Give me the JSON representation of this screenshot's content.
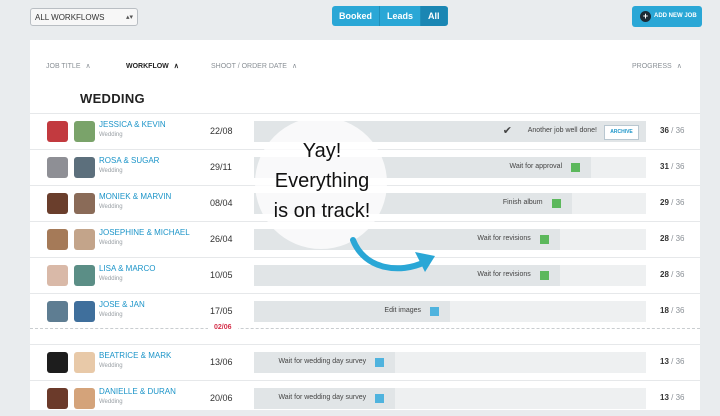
{
  "toolbar": {
    "workflow_select": "ALL WORKFLOWS",
    "filters": [
      "Booked",
      "Leads",
      "All"
    ],
    "active_filter": "All",
    "add_job_label": "ADD NEW JOB"
  },
  "table": {
    "headers": {
      "job_title": "JOB TITLE",
      "workflow": "WORKFLOW",
      "shoot_date": "SHOOT / ORDER DATE",
      "progress": "PROGRESS"
    },
    "section": "WEDDING",
    "rows": [
      {
        "name": "JESSICA & KEVIN",
        "type": "Wedding",
        "date": "22/08",
        "stage": "Another job well done!",
        "progress": 1.0,
        "done": "36",
        "total": "36",
        "archive": "ARCHIVE",
        "status_color": "none"
      },
      {
        "name": "ROSA & SUGAR",
        "type": "Wedding",
        "date": "29/11",
        "stage": "Wait for approval",
        "progress": 0.86,
        "done": "31",
        "total": "36",
        "status_color": "#5cb85c"
      },
      {
        "name": "MONIEK & MARVIN",
        "type": "Wedding",
        "date": "08/04",
        "stage": "Finish album",
        "progress": 0.81,
        "done": "29",
        "total": "36",
        "status_color": "#5cb85c"
      },
      {
        "name": "JOSEPHINE & MICHAEL",
        "type": "Wedding",
        "date": "26/04",
        "stage": "Wait for revisions",
        "progress": 0.78,
        "done": "28",
        "total": "36",
        "status_color": "#5cb85c"
      },
      {
        "name": "LISA & MARCO",
        "type": "Wedding",
        "date": "10/05",
        "stage": "Wait for revisions",
        "progress": 0.78,
        "done": "28",
        "total": "36",
        "status_color": "#5cb85c"
      },
      {
        "name": "JOSE & JAN",
        "type": "Wedding",
        "date": "17/05",
        "stage": "Edit images",
        "progress": 0.5,
        "done": "18",
        "total": "36",
        "status_color": "#4fb3de"
      },
      {
        "name": "BEATRICE & MARK",
        "type": "Wedding",
        "date": "13/06",
        "stage": "Wait for wedding day survey",
        "progress": 0.36,
        "done": "13",
        "total": "36",
        "status_color": "#4fb3de"
      },
      {
        "name": "DANIELLE & DURAN",
        "type": "Wedding",
        "date": "20/06",
        "stage": "Wait for wedding day survey",
        "progress": 0.36,
        "done": "13",
        "total": "36",
        "status_color": "#4fb3de"
      }
    ],
    "today_divider": "02/06"
  },
  "overlay": {
    "lines": [
      "Yay!",
      "Everything",
      "is on track!"
    ]
  },
  "colors": {
    "accent": "#2aa7d6",
    "link": "#1b94c8",
    "divider_label": "#d4304a",
    "arrow": "#2aa7d6"
  }
}
